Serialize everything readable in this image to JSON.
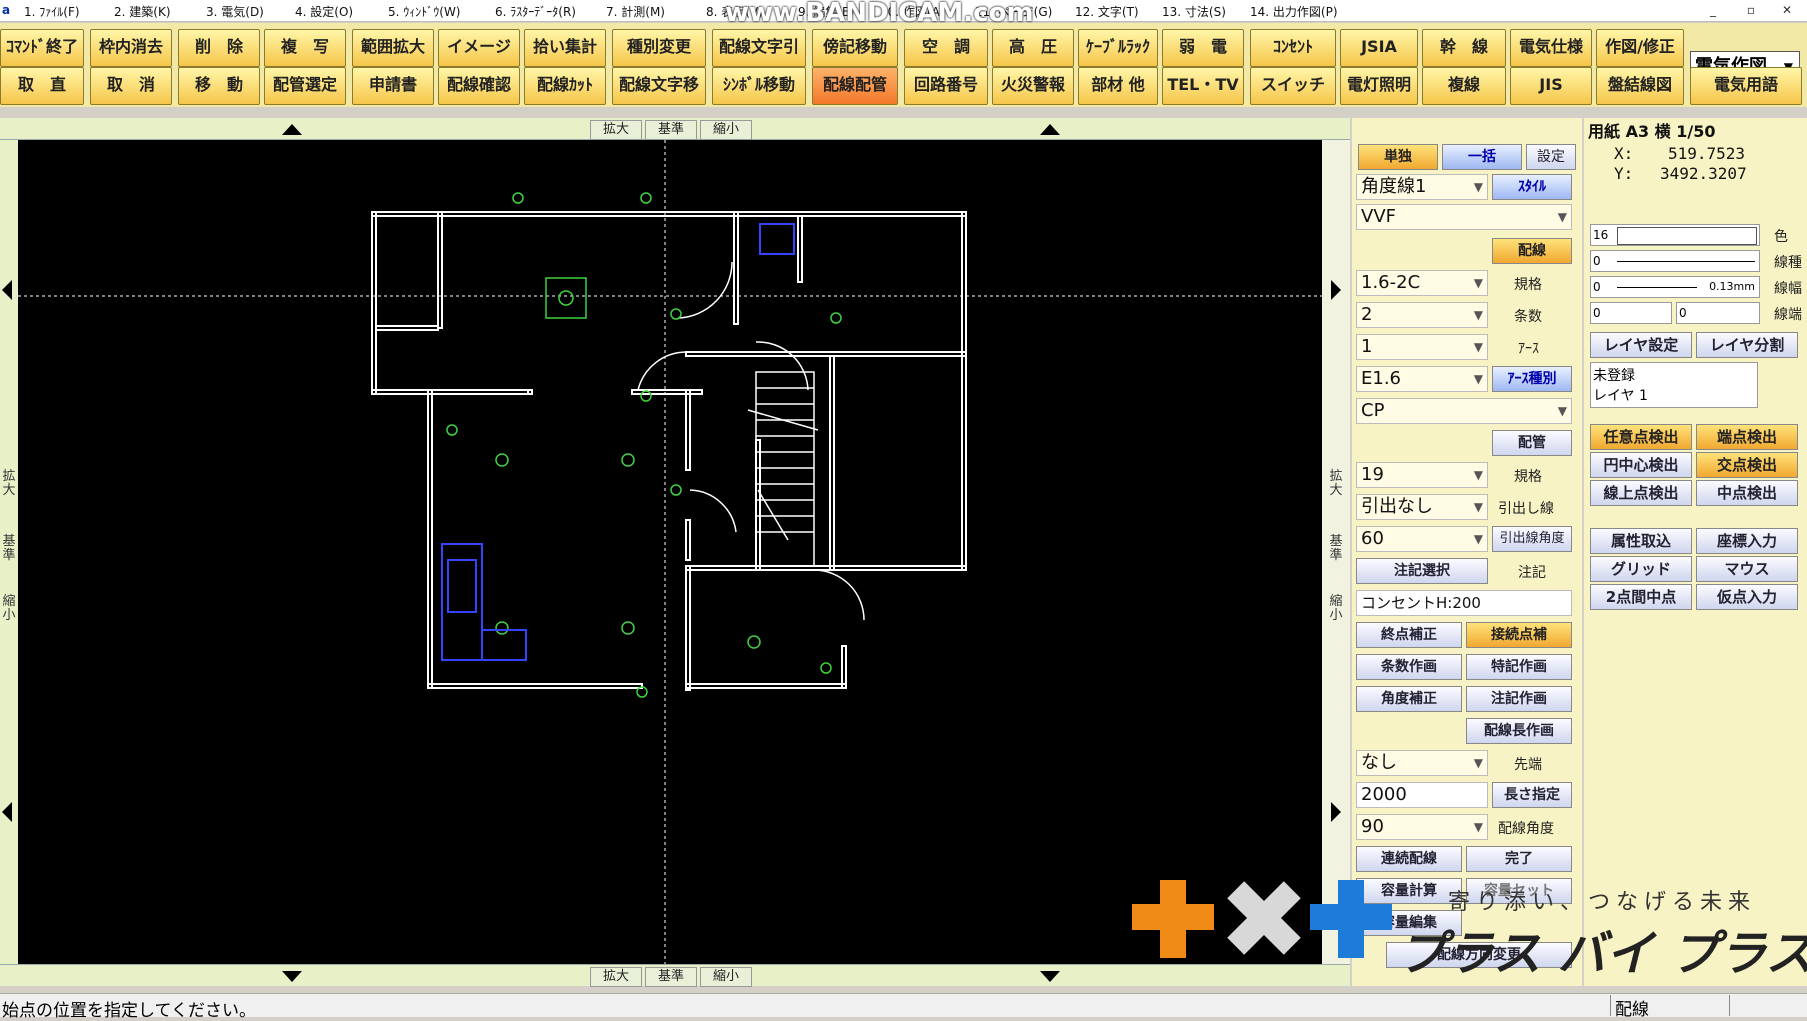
{
  "menu": {
    "app_icon": "a",
    "items": [
      "1. ﾌｧｲﾙ(F)",
      "2. 建築(K)",
      "3. 電気(D)",
      "4. 設定(O)",
      "5. ｳｨﾝﾄﾞｳ(W)",
      "6. ﾗｽﾀｰﾃﾞｰﾀ(R)",
      "7. 計測(M)",
      "8. 表示(V)",
      "9. 編集(E)",
      "10. 作図(A)",
      "11. ページ(G)",
      "12. 文字(T)",
      "13. 寸法(S)",
      "14. 出力作図(P)"
    ],
    "watermark": "www.BANDICAM.com",
    "win": [
      "_",
      "▫",
      "✕"
    ]
  },
  "toolbar": {
    "row1": [
      "ｺﾏﾝﾄﾞ終了",
      "枠内消去",
      "削　除",
      "複　写",
      "範囲拡大",
      "イメージ",
      "拾い集計",
      "種別変更",
      "配線文字引",
      "傍記移動",
      "空　調",
      "高　圧",
      "ｹｰﾌﾞﾙﾗｯｸ",
      "弱　電",
      "ｺﾝｾﾝﾄ",
      "JSIA",
      "幹　線",
      "電気仕様",
      "作図/修正"
    ],
    "row2": [
      "取　直",
      "取　消",
      "移　動",
      "配管選定",
      "申請書",
      "配線確認",
      "配線ｶｯﾄ",
      "配線文字移",
      "ｼﾝﾎﾞﾙ移動",
      "配線配管",
      "回路番号",
      "火災警報",
      "部材 他",
      "TEL・TV",
      "スイッチ",
      "電灯照明",
      "複線",
      "JIS",
      "盤結線図",
      "電気用語"
    ],
    "active": "配線配管",
    "mode_select": "電気作図"
  },
  "canvas": {
    "zoom_buttons": [
      "拡大",
      "基準",
      "縮小"
    ],
    "side_zoom": [
      "拡大",
      "基準",
      "縮小"
    ]
  },
  "mid_panel": {
    "tabs": [
      "単独",
      "一括",
      "設定"
    ],
    "angle_line": "角度線1",
    "style_btn": "ｽﾀｲﾙ",
    "cable_type": "VVF",
    "wiring_btn": "配線",
    "spec_value": "1.6-2C",
    "spec_label": "規格",
    "count_value": "2",
    "count_label": "条数",
    "earth_value": "1",
    "earth_label": "ｱｰｽ",
    "earth_type_value": "E1.6",
    "earth_type_btn": "ｱｰｽ種別",
    "pipe_type": "CP",
    "pipe_btn": "配管",
    "pipe_size_value": "19",
    "pipe_size_label": "規格",
    "leader_value": "引出なし",
    "leader_label": "引出し線",
    "leader_angle_value": "60",
    "leader_angle_label": "引出線角度",
    "note_select_btn": "注記選択",
    "note_label": "注記",
    "note_text": "コンセントH:200",
    "buttons_a": [
      "終点補正",
      "接続点補",
      "条数作画",
      "特記作画",
      "角度補正",
      "注記作画",
      "配線長作画"
    ],
    "tip_value": "なし",
    "tip_label": "先端",
    "length_value": "2000",
    "length_btn": "長さ指定",
    "angle_value": "90",
    "angle_label": "配線角度",
    "buttons_b": [
      "連続配線",
      "完了",
      "容量計算",
      "容量セット",
      "容量編集",
      "配線方向変更"
    ]
  },
  "right_panel": {
    "paper": "用紙 A3 横 1/50",
    "x_label": "X:",
    "x_value": "519.7523",
    "y_label": "Y:",
    "y_value": "3492.3207",
    "color_value": "16",
    "color_label": "色",
    "linetype_value": "0",
    "linetype_label": "線種",
    "linewidth_value": "0",
    "linewidth_mm": "0.13mm",
    "linewidth_label": "線幅",
    "lineend_value": "0",
    "lineend_value2": "0",
    "lineend_label": "線端",
    "layer_set_btn": "レイヤ設定",
    "layer_split_btn": "レイヤ分割",
    "layer_list": [
      "未登録",
      "レイヤ 1"
    ],
    "snap_buttons": [
      "任意点検出",
      "端点検出",
      "円中心検出",
      "交点検出",
      "線上点検出",
      "中点検出"
    ],
    "input_buttons": [
      "属性取込",
      "座標入力",
      "グリッド",
      "マウス",
      "2点間中点",
      "仮点入力"
    ]
  },
  "status": {
    "message": "始点の位置を指定してください。",
    "mode": "配線"
  },
  "logo": {
    "tagline": "寄り添い、つなげる未来",
    "brand": "プラス バイ プラス"
  }
}
